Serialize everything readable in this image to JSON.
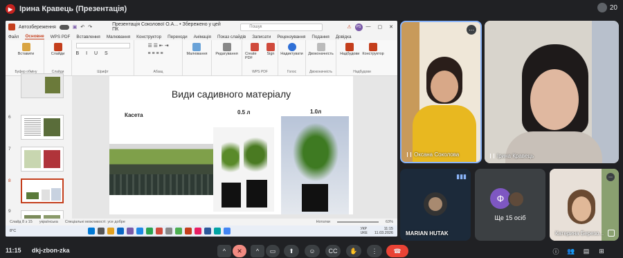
{
  "meeting": {
    "presenter_label": "Ірина Кравець (Презентація)",
    "participant_count": "20",
    "time": "11:15",
    "meeting_code": "dkj-zbon-zka"
  },
  "ppt": {
    "autosave_label": "Автозбереження",
    "doc_title": "Презентація Соколової О.А... • Збережено у цей ПК",
    "search_placeholder": "Пошук",
    "user_initials": "PS",
    "menu": [
      "Файл",
      "Основне",
      "WPS PDF",
      "Вставлення",
      "Малювання",
      "Конструктор",
      "Переходи",
      "Анімація",
      "Показ слайдів",
      "Записати",
      "Рецензування",
      "Подання",
      "Довідка"
    ],
    "active_menu": "Основне",
    "ribbon_groups": [
      {
        "label": "Буфер обміну",
        "buttons": [
          "Вставити"
        ]
      },
      {
        "label": "Слайди",
        "buttons": [
          "Слайди"
        ]
      },
      {
        "label": "Шрифт",
        "buttons": []
      },
      {
        "label": "Абзац",
        "buttons": []
      },
      {
        "label": "",
        "buttons": [
          "Малювання"
        ]
      },
      {
        "label": "",
        "buttons": [
          "Редагування"
        ]
      },
      {
        "label": "WPS PDF",
        "buttons": [
          "Create PDF",
          "Sign"
        ]
      },
      {
        "label": "Голос",
        "buttons": [
          "Надиктувати"
        ]
      },
      {
        "label": "Двоконачність",
        "buttons": [
          "Двоконачність"
        ]
      },
      {
        "label": "Надбудови",
        "buttons": [
          "Надбудови",
          "Конструктор"
        ]
      }
    ],
    "thumb_numbers": [
      "6",
      "7",
      "8",
      "9"
    ],
    "status": {
      "slide": "Слайд 8 з 15",
      "lang": "українська",
      "accessibility": "Спеціальні можливості: усе добре",
      "notes": "Нотатки",
      "zoom": "63%"
    },
    "taskbar": {
      "temp": "8°C",
      "lang": "УКР\nUKE",
      "time": "11:15",
      "date": "11.03.2026"
    }
  },
  "slide": {
    "title": "Види садивного матеріалу",
    "label_cassette": "Касета",
    "label_05": "0.5 л",
    "label_10": "1.0л"
  },
  "participants": [
    {
      "name": "Оксана Соколова"
    },
    {
      "name": "Ірина Кравець"
    },
    {
      "name": "MARIAN HUTAK"
    },
    {
      "name": "Ще 15 осіб",
      "initial": "Ф"
    },
    {
      "name": "Катерина Березо..."
    }
  ],
  "colors": {
    "meet_bg": "#202124",
    "tile_bg": "#3c4043",
    "ppt_accent": "#c43e1c",
    "hangup": "#ea4335",
    "avatar_purple": "#7e57c2"
  }
}
